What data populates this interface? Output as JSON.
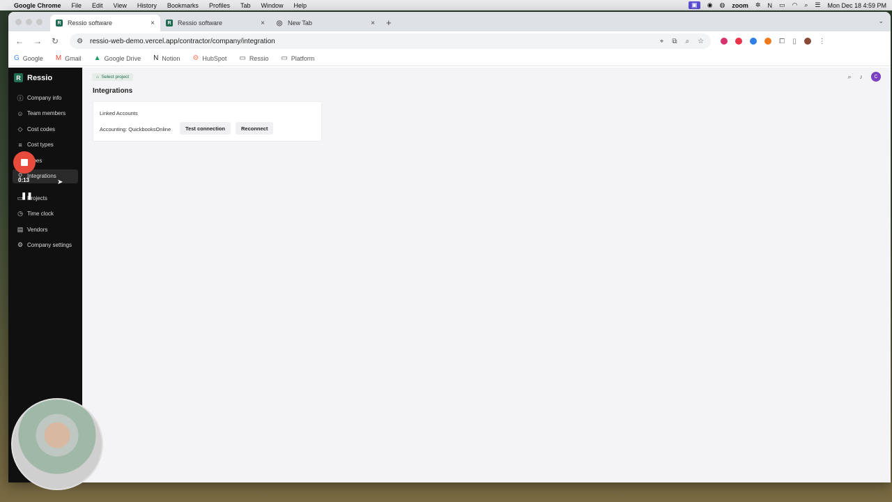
{
  "menubar": {
    "app": "Google Chrome",
    "items": [
      "File",
      "Edit",
      "View",
      "History",
      "Bookmarks",
      "Profiles",
      "Tab",
      "Window",
      "Help"
    ],
    "zoom": "zoom",
    "datetime": "Mon Dec 18  4:59 PM"
  },
  "tabs": [
    {
      "title": "Ressio software"
    },
    {
      "title": "Ressio software"
    },
    {
      "title": "New Tab"
    }
  ],
  "address": {
    "url": "ressio-web-demo.vercel.app/contractor/company/integration"
  },
  "bookmarks": [
    "Google",
    "Gmail",
    "Google Drive",
    "Notion",
    "HubSpot",
    "Ressio",
    "Platform"
  ],
  "sidebar": {
    "brand": "Ressio",
    "items": [
      {
        "label": "Company info"
      },
      {
        "label": "Team members"
      },
      {
        "label": "Cost codes"
      },
      {
        "label": "Cost types"
      },
      {
        "label": "Types"
      },
      {
        "label": "Integrations"
      },
      {
        "label": "Projects"
      },
      {
        "label": "Time clock"
      },
      {
        "label": "Vendors"
      },
      {
        "label": "Company settings"
      }
    ]
  },
  "main": {
    "project_pill": "Select project",
    "title": "Integrations",
    "card": {
      "title": "Linked Accounts",
      "account_label": "Accounting: QuickbooksOnline",
      "test_button": "Test connection",
      "reconnect_button": "Reconnect"
    },
    "avatar_initial": "C"
  },
  "recorder": {
    "time": "0:13"
  }
}
